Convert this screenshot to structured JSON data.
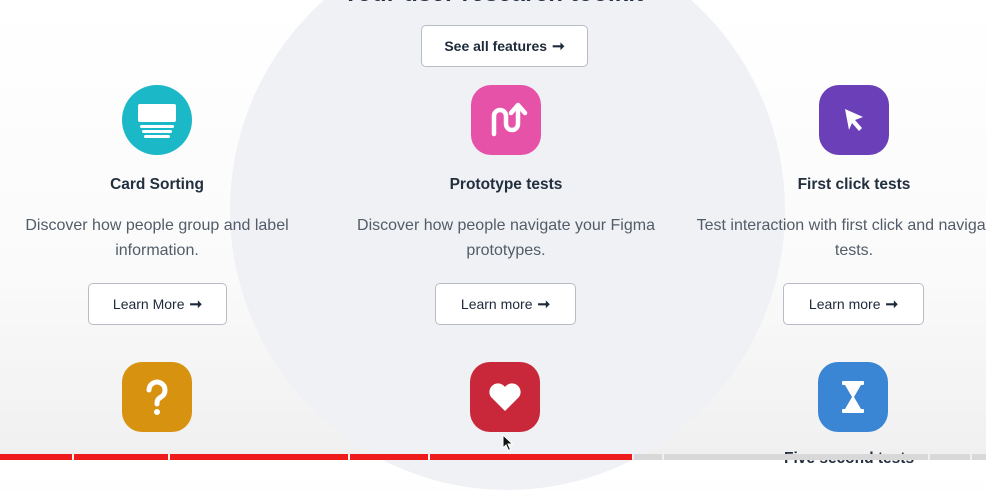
{
  "colors": {
    "card_sorting": "#1bb8c8",
    "prototype": "#e552a8",
    "first_click": "#6a3fb8",
    "surveys": "#d79210",
    "preference": "#c8283a",
    "five_second": "#3a86d4",
    "bar_red": "#ee1c1c",
    "bar_grey": "#d8d8d8"
  },
  "top_heading": "Your user research toolkit",
  "see_all_button": {
    "label": "See all features",
    "arrow": "➞"
  },
  "cards": [
    {
      "icon": "card-stack-icon",
      "title": "Card Sorting",
      "description": "Discover how people group and label information.",
      "button": "Learn More",
      "arrow": "➞"
    },
    {
      "icon": "prototype-path-icon",
      "title": "Prototype tests",
      "description": "Discover how people navigate your Figma prototypes.",
      "button": "Learn more",
      "arrow": "➞"
    },
    {
      "icon": "cursor-arrow-icon",
      "title": "First click tests",
      "description": "Test interaction with first click and navigation tests.",
      "button": "Learn more",
      "arrow": "➞"
    }
  ],
  "row2": [
    {
      "icon": "question-mark-icon"
    },
    {
      "icon": "heart-icon"
    },
    {
      "icon": "hourglass-icon",
      "title": "Five second tests"
    }
  ]
}
